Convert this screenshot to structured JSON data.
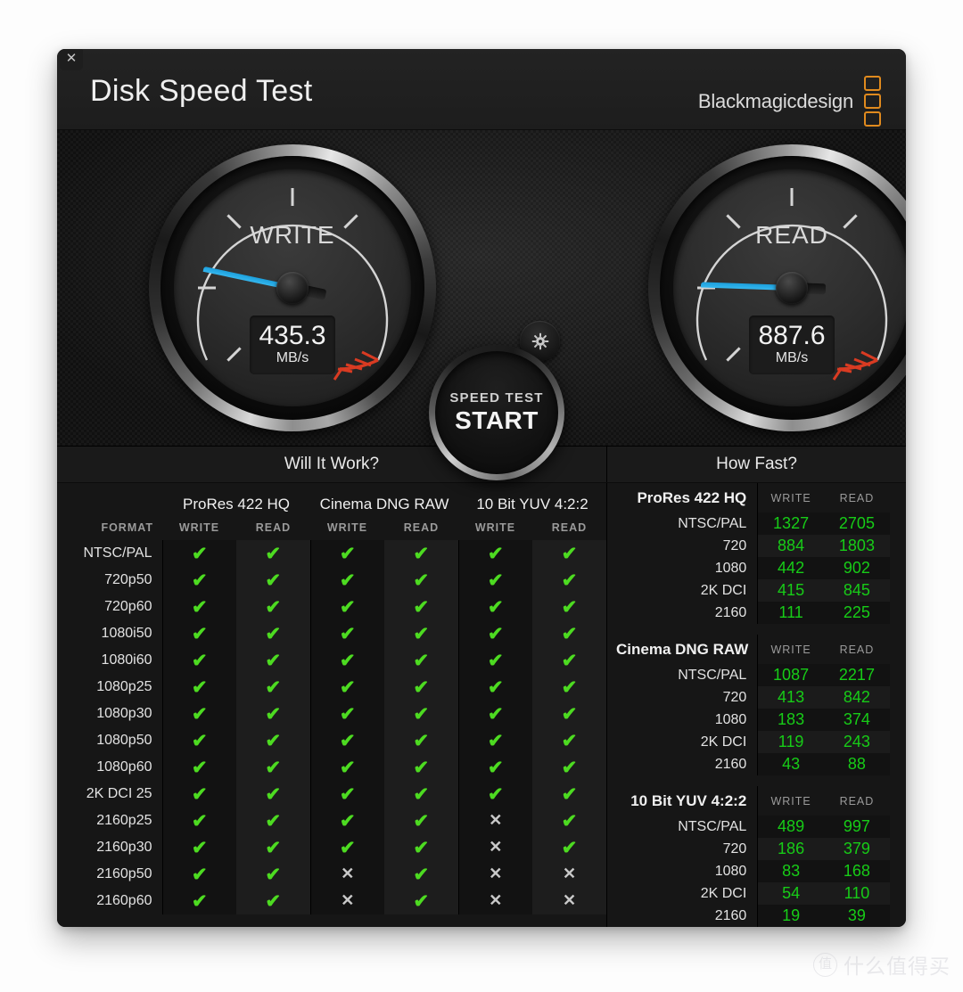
{
  "window": {
    "title": "Disk Speed Test",
    "close_label": "✕",
    "brand": "Blackmagicdesign"
  },
  "gauges": {
    "write": {
      "label": "WRITE",
      "value": "435.3",
      "unit": "MB/s"
    },
    "read": {
      "label": "READ",
      "value": "887.6",
      "unit": "MB/s"
    }
  },
  "controls": {
    "settings_icon": "gear-icon",
    "start_small": "SPEED TEST",
    "start_big": "START"
  },
  "sections": {
    "will_it_work": "Will It Work?",
    "how_fast": "How Fast?"
  },
  "will_it_work": {
    "format_header": "FORMAT",
    "groups": [
      "ProRes 422 HQ",
      "Cinema DNG RAW",
      "10 Bit YUV 4:2:2"
    ],
    "sub_headers": [
      "WRITE",
      "READ"
    ],
    "mark_ok": "✔",
    "mark_no": "✕",
    "rows": [
      {
        "format": "NTSC/PAL",
        "marks": [
          true,
          true,
          true,
          true,
          true,
          true
        ]
      },
      {
        "format": "720p50",
        "marks": [
          true,
          true,
          true,
          true,
          true,
          true
        ]
      },
      {
        "format": "720p60",
        "marks": [
          true,
          true,
          true,
          true,
          true,
          true
        ]
      },
      {
        "format": "1080i50",
        "marks": [
          true,
          true,
          true,
          true,
          true,
          true
        ]
      },
      {
        "format": "1080i60",
        "marks": [
          true,
          true,
          true,
          true,
          true,
          true
        ]
      },
      {
        "format": "1080p25",
        "marks": [
          true,
          true,
          true,
          true,
          true,
          true
        ]
      },
      {
        "format": "1080p30",
        "marks": [
          true,
          true,
          true,
          true,
          true,
          true
        ]
      },
      {
        "format": "1080p50",
        "marks": [
          true,
          true,
          true,
          true,
          true,
          true
        ]
      },
      {
        "format": "1080p60",
        "marks": [
          true,
          true,
          true,
          true,
          true,
          true
        ]
      },
      {
        "format": "2K DCI 25",
        "marks": [
          true,
          true,
          true,
          true,
          true,
          true
        ]
      },
      {
        "format": "2160p25",
        "marks": [
          true,
          true,
          true,
          true,
          false,
          true
        ]
      },
      {
        "format": "2160p30",
        "marks": [
          true,
          true,
          true,
          true,
          false,
          true
        ]
      },
      {
        "format": "2160p50",
        "marks": [
          true,
          true,
          false,
          true,
          false,
          false
        ]
      },
      {
        "format": "2160p60",
        "marks": [
          true,
          true,
          false,
          true,
          false,
          false
        ]
      }
    ]
  },
  "how_fast": {
    "sub_headers": [
      "WRITE",
      "READ"
    ],
    "groups": [
      {
        "name": "ProRes 422 HQ",
        "rows": [
          {
            "label": "NTSC/PAL",
            "write": "1327",
            "read": "2705"
          },
          {
            "label": "720",
            "write": "884",
            "read": "1803"
          },
          {
            "label": "1080",
            "write": "442",
            "read": "902"
          },
          {
            "label": "2K DCI",
            "write": "415",
            "read": "845"
          },
          {
            "label": "2160",
            "write": "111",
            "read": "225"
          }
        ]
      },
      {
        "name": "Cinema DNG RAW",
        "rows": [
          {
            "label": "NTSC/PAL",
            "write": "1087",
            "read": "2217"
          },
          {
            "label": "720",
            "write": "413",
            "read": "842"
          },
          {
            "label": "1080",
            "write": "183",
            "read": "374"
          },
          {
            "label": "2K DCI",
            "write": "119",
            "read": "243"
          },
          {
            "label": "2160",
            "write": "43",
            "read": "88"
          }
        ]
      },
      {
        "name": "10 Bit YUV 4:2:2",
        "rows": [
          {
            "label": "NTSC/PAL",
            "write": "489",
            "read": "997"
          },
          {
            "label": "720",
            "write": "186",
            "read": "379"
          },
          {
            "label": "1080",
            "write": "83",
            "read": "168"
          },
          {
            "label": "2K DCI",
            "write": "54",
            "read": "110"
          },
          {
            "label": "2160",
            "write": "19",
            "read": "39"
          }
        ]
      }
    ]
  },
  "watermark": {
    "mark": "值",
    "text": "什么值得买"
  },
  "colors": {
    "accent_green": "#17cc17",
    "check_green": "#4ddb21",
    "needle_blue": "#29ace0",
    "brand_orange": "#e08a1e",
    "red_zone": "#d93b22"
  },
  "needles": {
    "write_angle_deg": 192,
    "read_angle_deg": 182
  }
}
